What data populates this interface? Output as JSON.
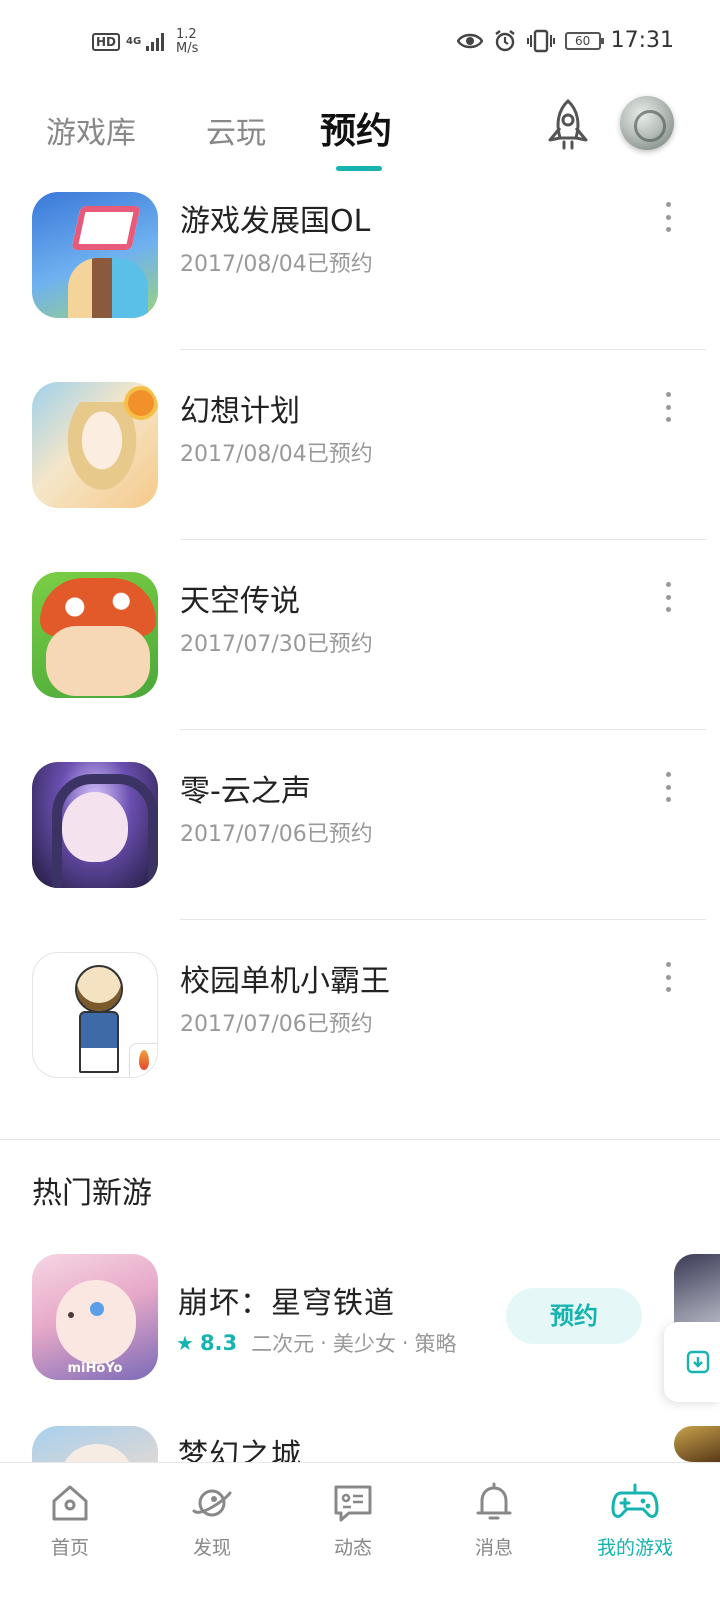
{
  "status_bar": {
    "hd": "HD",
    "network": "4G",
    "speed_value": "1.2",
    "speed_unit": "M/s",
    "battery": "60",
    "time": "17:31"
  },
  "tabs": [
    {
      "label": "游戏库",
      "active": false
    },
    {
      "label": "云玩",
      "active": false
    },
    {
      "label": "预约",
      "active": true
    }
  ],
  "reserved_games": [
    {
      "name": "游戏发展国OL",
      "date": "2017/08/04已预约"
    },
    {
      "name": "幻想计划",
      "date": "2017/08/04已预约"
    },
    {
      "name": "天空传说",
      "date": "2017/07/30已预约"
    },
    {
      "name": "零-云之声",
      "date": "2017/07/06已预约"
    },
    {
      "name": "校园单机小霸王",
      "date": "2017/07/06已预约"
    }
  ],
  "hot_section": {
    "title": "热门新游",
    "games": [
      {
        "name": "崩坏：星穹铁道",
        "rating": "8.3",
        "tags": [
          "二次元",
          "美少女",
          "策略"
        ],
        "button": "预约",
        "icon_text": "miHoYo"
      },
      {
        "name": "梦幻之城"
      }
    ]
  },
  "bottom_nav": [
    {
      "label": "首页",
      "icon": "home-icon",
      "active": false
    },
    {
      "label": "发现",
      "icon": "planet-icon",
      "active": false
    },
    {
      "label": "动态",
      "icon": "chat-icon",
      "active": false
    },
    {
      "label": "消息",
      "icon": "bell-icon",
      "active": false
    },
    {
      "label": "我的游戏",
      "icon": "gamepad-icon",
      "active": true
    }
  ],
  "colors": {
    "accent": "#17b3b0",
    "accent_light": "#e6f7f7",
    "text_primary": "#222222",
    "text_secondary": "#999999"
  }
}
